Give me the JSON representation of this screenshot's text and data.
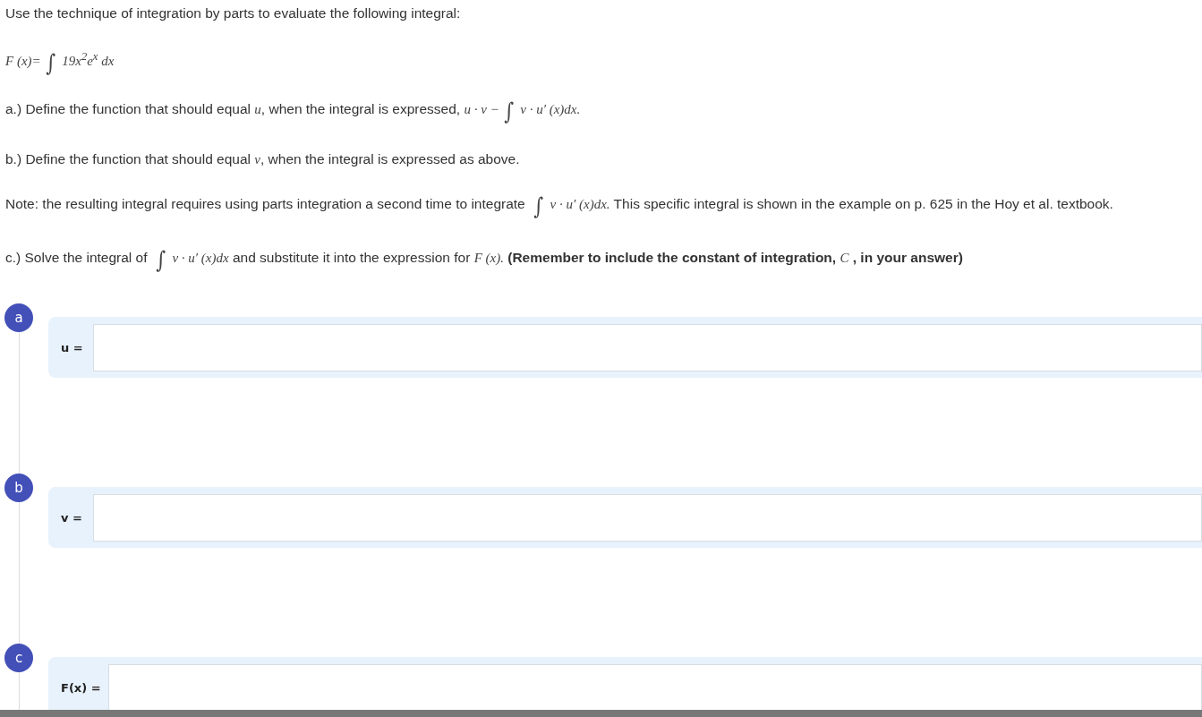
{
  "paragraphs": [
    {
      "segments": [
        {
          "kind": "text",
          "text": "Use the technique of integration by parts to evaluate the following integral:"
        }
      ]
    },
    {
      "segments": [
        {
          "kind": "math",
          "text": "F (x)="
        },
        {
          "kind": "integral",
          "text": "∫"
        },
        {
          "kind": "math",
          "text": "19x$^{2}$e$^{x}$ dx"
        }
      ]
    },
    {
      "segments": [
        {
          "kind": "text",
          "text": "a.) Define the function that should equal "
        },
        {
          "kind": "math",
          "text": "u"
        },
        {
          "kind": "text",
          "text": ", when the integral is expressed, "
        },
        {
          "kind": "math",
          "text": "u · v −"
        },
        {
          "kind": "integral",
          "text": "∫"
        },
        {
          "kind": "math",
          "text": "v · u′ (x)dx."
        }
      ]
    },
    {
      "segments": [
        {
          "kind": "text",
          "text": "b.) Define the function that should equal "
        },
        {
          "kind": "math",
          "text": "v"
        },
        {
          "kind": "text",
          "text": ", when the integral is expressed as above."
        }
      ]
    },
    {
      "segments": [
        {
          "kind": "text",
          "text": "Note:  the resulting integral requires using parts integration a second time to integrate "
        },
        {
          "kind": "integral",
          "text": "∫"
        },
        {
          "kind": "math",
          "text": "v · u′ (x)dx."
        },
        {
          "kind": "text",
          "text": "  This specific integral is shown in the example on p. 625 in the Hoy et al. textbook."
        }
      ]
    },
    {
      "segments": [
        {
          "kind": "text",
          "text": "c.) Solve the integral of "
        },
        {
          "kind": "integral",
          "text": "∫"
        },
        {
          "kind": "math",
          "text": "v · u′ (x)dx"
        },
        {
          "kind": "text",
          "text": " and substitute it into the expression for "
        },
        {
          "kind": "math",
          "text": "F (x)."
        },
        {
          "kind": "bold",
          "text": "  (Remember to include the constant of integration, "
        },
        {
          "kind": "math",
          "text": "C"
        },
        {
          "kind": "bold",
          "text": " , in your answer)"
        }
      ]
    }
  ],
  "parts": [
    {
      "badge": "a",
      "label": "u ="
    },
    {
      "badge": "b",
      "label": "v ="
    },
    {
      "badge": "c",
      "label": "F(x) ="
    }
  ]
}
